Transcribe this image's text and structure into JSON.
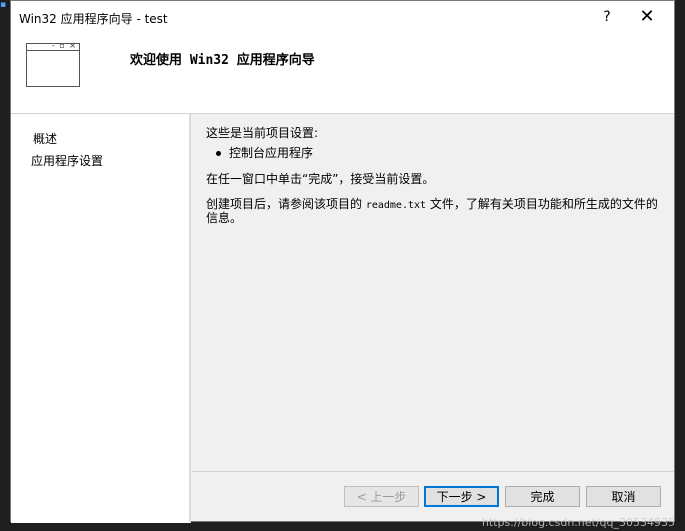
{
  "window": {
    "title": "Win32 应用程序向导 - test",
    "help_label": "?",
    "close_label": "✕"
  },
  "header": {
    "title": "欢迎使用 Win32 应用程序向导",
    "icon": "wizard-window-icon"
  },
  "sidebar": {
    "items": [
      {
        "label": "概述"
      },
      {
        "label": "应用程序设置"
      }
    ]
  },
  "content": {
    "line1": "这些是当前项目设置:",
    "bullet": "控制台应用程序",
    "line2": "在任一窗口中单击“完成”，接受当前设置。",
    "line3_before": "创建项目后，请参阅该项目的 ",
    "line3_file": "readme.txt",
    "line3_after": " 文件，了解有关项目功能和所生成的文件的信息。"
  },
  "buttons": {
    "prev": "< 上一步",
    "next": "下一步 >",
    "finish": "完成",
    "cancel": "取消"
  },
  "watermark": "https://blog.csdn.net/qq_30534935",
  "colors": {
    "accent": "#0078d7",
    "dialog_bg": "#f0f0f0",
    "panel_bg": "#ffffff"
  }
}
